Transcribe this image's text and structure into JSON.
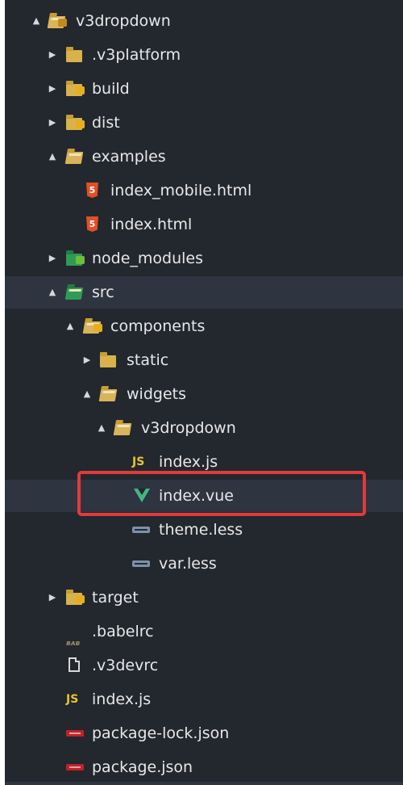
{
  "explorer": {
    "items": [
      {
        "label": "v3dropdown",
        "icon": "folder-open-project-icon",
        "arrow": "▲"
      },
      {
        "label": ".v3platform",
        "icon": "folder-icon",
        "arrow": "▶"
      },
      {
        "label": "build",
        "icon": "folder-build-icon",
        "arrow": "▶"
      },
      {
        "label": "dist",
        "icon": "folder-dist-icon",
        "arrow": "▶"
      },
      {
        "label": "examples",
        "icon": "folder-open-icon",
        "arrow": "▲"
      },
      {
        "label": "index_mobile.html",
        "icon": "html5-icon",
        "glyph": "5"
      },
      {
        "label": "index.html",
        "icon": "html5-icon",
        "glyph": "5"
      },
      {
        "label": "node_modules",
        "icon": "folder-node-icon",
        "arrow": "▶"
      },
      {
        "label": "src",
        "icon": "folder-src-icon",
        "arrow": "▲"
      },
      {
        "label": "components",
        "icon": "folder-open-components-icon",
        "arrow": "▲"
      },
      {
        "label": "static",
        "icon": "folder-icon",
        "arrow": "▶"
      },
      {
        "label": "widgets",
        "icon": "folder-open-icon",
        "arrow": "▲"
      },
      {
        "label": "v3dropdown",
        "icon": "folder-open-icon",
        "arrow": "▲"
      },
      {
        "label": "index.js",
        "icon": "js-icon",
        "glyph": "JS"
      },
      {
        "label": "index.vue",
        "icon": "vue-icon"
      },
      {
        "label": "theme.less",
        "icon": "less-icon"
      },
      {
        "label": "var.less",
        "icon": "less-icon"
      },
      {
        "label": "target",
        "icon": "folder-target-icon",
        "arrow": "▶"
      },
      {
        "label": ".babelrc",
        "icon": "babel-icon",
        "glyph": "ʙᴀʙ"
      },
      {
        "label": ".v3devrc",
        "icon": "file-icon"
      },
      {
        "label": "index.js",
        "icon": "js-icon",
        "glyph": "JS"
      },
      {
        "label": "package-lock.json",
        "icon": "npm-icon"
      },
      {
        "label": "package.json",
        "icon": "npm-icon"
      }
    ]
  },
  "colors": {
    "background": "#23272e",
    "selected_row": "#2e3540",
    "highlight_box": "#e23a3a",
    "vue_green": "#41b883",
    "folder_yellow": "#d8b24a"
  }
}
